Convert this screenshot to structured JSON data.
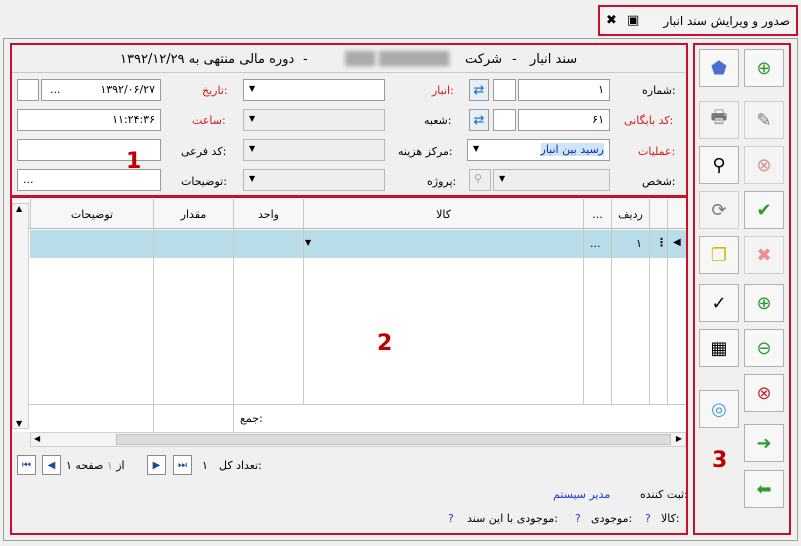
{
  "tab": {
    "title": "صدور و ویرایش سند انبار"
  },
  "header": {
    "doc_type": "سند انبار",
    "company_label": "شرکت",
    "company_name": "███ ███████",
    "fiscal_period": "دوره مالی  منتهی به ۱۳۹۲/۱۲/۲۹"
  },
  "form": {
    "number_label": "شماره:",
    "number_value": "۱",
    "warehouse_label": "انبار:",
    "date_label": "تاریخ:",
    "date_value": "۱۳۹۲/۰۶/۲۷",
    "date_btn": "...",
    "archive_label": "کد بایگانی:",
    "archive_value": "۶۱",
    "branch_label": "شعبه:",
    "time_label": "ساعت:",
    "time_value": "۱۱:۲۴:۳۶",
    "operation_label": "عملیات:",
    "operation_value": "رسید بین انبار",
    "cost_center_label": "مرکز هزینه:",
    "subcode_label": "کد فرعی:",
    "person_label": "شخص:",
    "project_label": "پروژه:",
    "desc_label": "توضیحات:",
    "desc_value": "..."
  },
  "grid": {
    "columns": [
      "ردیف",
      "...",
      "کالا",
      "واحد",
      "مقدار",
      "توضیحات"
    ],
    "rows": [
      {
        "row": "۱",
        "more": "..."
      }
    ],
    "sum_label": "جمع:"
  },
  "pager": {
    "total_label": "تعداد کل:",
    "total_value": "۱",
    "page_label": "صفحه",
    "page_value": "۱",
    "of_label": "از",
    "of_value": "۱"
  },
  "footer": {
    "registrar_label": "ثبت کننده:",
    "registrar_value": "مدیر سیستم",
    "item_label": "کالا:",
    "item_value": "?",
    "stock_label": "موجودی:",
    "stock_value": "?",
    "stock_doc_label": "موجودی با این سند:",
    "stock_doc_value": "?"
  },
  "markers": {
    "m1": "1",
    "m2": "2",
    "m3": "3"
  }
}
